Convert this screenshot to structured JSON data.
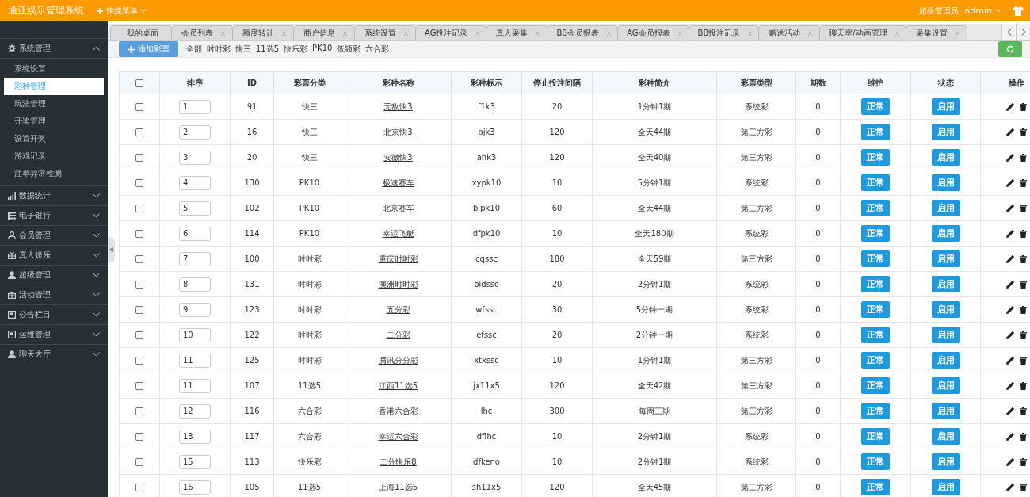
{
  "header": {
    "title": "通亚娱乐管理系统",
    "quick_menu": "快捷菜单",
    "role": "超级管理员",
    "user": "admin"
  },
  "sidebar": {
    "items": [
      {
        "label": "系统管理",
        "expanded": true,
        "children": [
          {
            "label": "系统设置",
            "selected": false
          },
          {
            "label": "彩种管理",
            "selected": true
          },
          {
            "label": "玩法管理",
            "selected": false
          },
          {
            "label": "开奖管理",
            "selected": false
          },
          {
            "label": "设置开奖",
            "selected": false
          },
          {
            "label": "游戏记录",
            "selected": false
          },
          {
            "label": "注单异常检测",
            "selected": false
          }
        ]
      },
      {
        "label": "数据统计",
        "expanded": false
      },
      {
        "label": "电子银行",
        "expanded": false
      },
      {
        "label": "会员管理",
        "expanded": false
      },
      {
        "label": "真人娱乐",
        "expanded": false
      },
      {
        "label": "超级管理",
        "expanded": false
      },
      {
        "label": "活动管理",
        "expanded": false
      },
      {
        "label": "公告栏目",
        "expanded": false
      },
      {
        "label": "运维管理",
        "expanded": false
      },
      {
        "label": "聊天大厅",
        "expanded": false
      }
    ]
  },
  "tabs": [
    {
      "label": "我的桌面",
      "closable": false,
      "selected": false
    },
    {
      "label": "会员列表",
      "closable": true,
      "selected": false
    },
    {
      "label": "额度转让",
      "closable": true,
      "selected": false
    },
    {
      "label": "商户信息",
      "closable": true,
      "selected": false
    },
    {
      "label": "系统设置",
      "closable": true,
      "selected": false
    },
    {
      "label": "AG投注记录",
      "closable": true,
      "selected": false
    },
    {
      "label": "真人采集",
      "closable": true,
      "selected": false
    },
    {
      "label": "BB会员报表",
      "closable": true,
      "selected": false
    },
    {
      "label": "AG会员报表",
      "closable": true,
      "selected": false
    },
    {
      "label": "BB投注记录",
      "closable": true,
      "selected": false
    },
    {
      "label": "赠送活动",
      "closable": true,
      "selected": false
    },
    {
      "label": "聊天室/动画管理",
      "closable": true,
      "selected": false
    },
    {
      "label": "采集设置",
      "closable": true,
      "selected": false
    }
  ],
  "toolbar": {
    "add_button": "添加彩票",
    "filters": [
      "全部",
      "时时彩",
      "快三",
      "11选5",
      "快乐彩",
      "PK10",
      "低频彩",
      "六合彩"
    ]
  },
  "table": {
    "select_all_checked": false,
    "columns": [
      "排序",
      "ID",
      "彩票分类",
      "彩种名称",
      "彩种标示",
      "停止投注间隔",
      "彩种简介",
      "彩票类型",
      "期数",
      "维护",
      "状态",
      "操作"
    ],
    "rows": [
      {
        "checked": false,
        "order": "1",
        "id": "91",
        "category": "快三",
        "name": "无敌快3",
        "code": "f1k3",
        "interval": "20",
        "intro": "1分钟1期",
        "type": "系统彩",
        "periods": "0",
        "maintenance": "正常",
        "status": "启用"
      },
      {
        "checked": false,
        "order": "2",
        "id": "16",
        "category": "快三",
        "name": "北京快3",
        "code": "bjk3",
        "interval": "120",
        "intro": "全天44期",
        "type": "第三方彩",
        "periods": "0",
        "maintenance": "正常",
        "status": "启用"
      },
      {
        "checked": false,
        "order": "3",
        "id": "20",
        "category": "快三",
        "name": "安徽快3",
        "code": "ahk3",
        "interval": "120",
        "intro": "全天40期",
        "type": "第三方彩",
        "periods": "0",
        "maintenance": "正常",
        "status": "启用"
      },
      {
        "checked": false,
        "order": "4",
        "id": "130",
        "category": "PK10",
        "name": "极速赛车",
        "code": "xypk10",
        "interval": "10",
        "intro": "5分钟1期",
        "type": "系统彩",
        "periods": "0",
        "maintenance": "正常",
        "status": "启用"
      },
      {
        "checked": false,
        "order": "5",
        "id": "102",
        "category": "PK10",
        "name": "北京赛车",
        "code": "bjpk10",
        "interval": "60",
        "intro": "全天44期",
        "type": "第三方彩",
        "periods": "0",
        "maintenance": "正常",
        "status": "启用"
      },
      {
        "checked": false,
        "order": "6",
        "id": "114",
        "category": "PK10",
        "name": "幸运飞艇",
        "code": "dfpk10",
        "interval": "10",
        "intro": "全天180期",
        "type": "系统彩",
        "periods": "0",
        "maintenance": "正常",
        "status": "启用"
      },
      {
        "checked": false,
        "order": "7",
        "id": "100",
        "category": "时时彩",
        "name": "重庆时时彩",
        "code": "cqssc",
        "interval": "180",
        "intro": "全天59期",
        "type": "第三方彩",
        "periods": "0",
        "maintenance": "正常",
        "status": "启用"
      },
      {
        "checked": false,
        "order": "8",
        "id": "131",
        "category": "时时彩",
        "name": "澳洲时时彩",
        "code": "oldssc",
        "interval": "20",
        "intro": "2分钟1期",
        "type": "系统彩",
        "periods": "0",
        "maintenance": "正常",
        "status": "启用"
      },
      {
        "checked": false,
        "order": "9",
        "id": "123",
        "category": "时时彩",
        "name": "五分彩",
        "code": "wfssc",
        "interval": "30",
        "intro": "5分钟一期",
        "type": "系统彩",
        "periods": "0",
        "maintenance": "正常",
        "status": "启用"
      },
      {
        "checked": false,
        "order": "10",
        "id": "122",
        "category": "时时彩",
        "name": "二分彩",
        "code": "efssc",
        "interval": "20",
        "intro": "2分钟一期",
        "type": "系统彩",
        "periods": "0",
        "maintenance": "正常",
        "status": "启用"
      },
      {
        "checked": false,
        "order": "11",
        "id": "125",
        "category": "时时彩",
        "name": "腾讯分分彩",
        "code": "xtxssc",
        "interval": "10",
        "intro": "1分钟1期",
        "type": "第三方彩",
        "periods": "0",
        "maintenance": "正常",
        "status": "启用"
      },
      {
        "checked": false,
        "order": "11",
        "id": "107",
        "category": "11选5",
        "name": "江西11选5",
        "code": "jx11x5",
        "interval": "120",
        "intro": "全天42期",
        "type": "第三方彩",
        "periods": "0",
        "maintenance": "正常",
        "status": "启用"
      },
      {
        "checked": false,
        "order": "12",
        "id": "116",
        "category": "六合彩",
        "name": "香港六合彩",
        "code": "lhc",
        "interval": "300",
        "intro": "每周三期",
        "type": "第三方彩",
        "periods": "0",
        "maintenance": "正常",
        "status": "启用"
      },
      {
        "checked": false,
        "order": "13",
        "id": "117",
        "category": "六合彩",
        "name": "幸运六合彩",
        "code": "dflhc",
        "interval": "10",
        "intro": "2分钟1期",
        "type": "系统彩",
        "periods": "0",
        "maintenance": "正常",
        "status": "启用"
      },
      {
        "checked": false,
        "order": "15",
        "id": "113",
        "category": "快乐彩",
        "name": "二分快乐8",
        "code": "dfkeno",
        "interval": "10",
        "intro": "2分钟1期",
        "type": "系统彩",
        "periods": "0",
        "maintenance": "正常",
        "status": "启用"
      },
      {
        "checked": false,
        "order": "16",
        "id": "105",
        "category": "11选5",
        "name": "上海11选5",
        "code": "sh11x5",
        "interval": "120",
        "intro": "全天45期",
        "type": "第三方彩",
        "periods": "0",
        "maintenance": "正常",
        "status": "启用"
      }
    ]
  }
}
